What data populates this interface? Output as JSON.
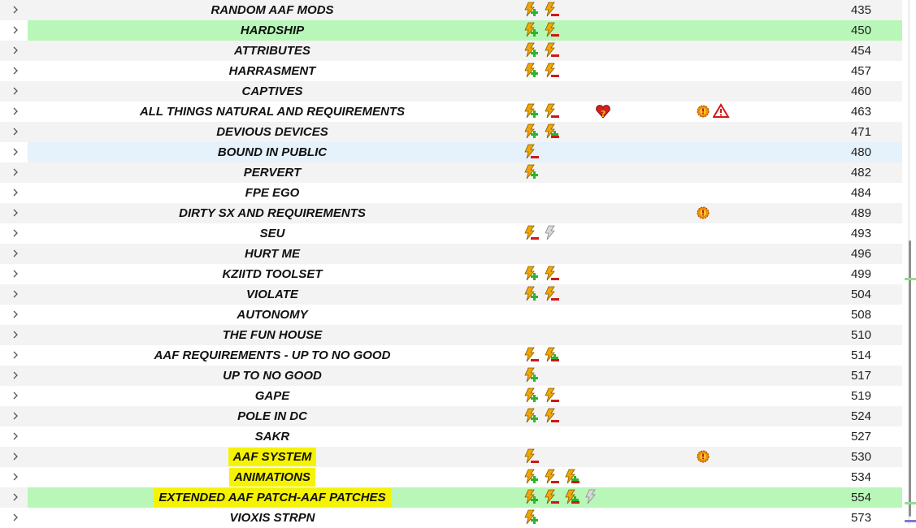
{
  "rows": [
    {
      "name": "RANDOM AAF MODS",
      "priority": "435",
      "icons": [
        "plugin-add",
        "plugin-remove"
      ],
      "extras": []
    },
    {
      "name": "HARDSHIP",
      "priority": "450",
      "highlight": "green",
      "icons": [
        "plugin-add",
        "plugin-remove"
      ],
      "extras": []
    },
    {
      "name": "ATTRIBUTES",
      "priority": "454",
      "icons": [
        "plugin-add",
        "plugin-remove"
      ],
      "extras": []
    },
    {
      "name": "HARRASMENT",
      "priority": "457",
      "icons": [
        "plugin-add",
        "plugin-remove"
      ],
      "extras": []
    },
    {
      "name": "CAPTIVES",
      "priority": "460",
      "icons": [],
      "extras": []
    },
    {
      "name": "ALL THINGS NATURAL AND REQUIREMENTS",
      "priority": "463",
      "icons": [
        "plugin-add",
        "plugin-remove"
      ],
      "extras": [
        "heart-question",
        "gear-badge",
        "warning"
      ]
    },
    {
      "name": "DEVIOUS DEVICES",
      "priority": "471",
      "icons": [
        "plugin-add",
        "plugin-add-remove"
      ],
      "extras": []
    },
    {
      "name": "BOUND IN PUBLIC",
      "priority": "480",
      "highlight": "blue",
      "icons": [
        "plugin-remove"
      ],
      "extras": []
    },
    {
      "name": "PERVERT",
      "priority": "482",
      "icons": [
        "plugin-add"
      ],
      "extras": []
    },
    {
      "name": "FPE EGO",
      "priority": "484",
      "icons": [],
      "extras": []
    },
    {
      "name": "DIRTY SX AND REQUIREMENTS",
      "priority": "489",
      "icons": [],
      "extras": [
        "gear-badge"
      ]
    },
    {
      "name": "SEU",
      "priority": "493",
      "icons": [
        "plugin-remove",
        "plugin-grey"
      ],
      "extras": []
    },
    {
      "name": "HURT ME",
      "priority": "496",
      "icons": [],
      "extras": []
    },
    {
      "name": "KZIITD TOOLSET",
      "priority": "499",
      "icons": [
        "plugin-add",
        "plugin-remove"
      ],
      "extras": []
    },
    {
      "name": "VIOLATE",
      "priority": "504",
      "icons": [
        "plugin-add",
        "plugin-remove"
      ],
      "extras": []
    },
    {
      "name": "AUTONOMY",
      "priority": "508",
      "icons": [],
      "extras": []
    },
    {
      "name": "THE FUN HOUSE",
      "priority": "510",
      "icons": [],
      "extras": []
    },
    {
      "name": "AAF REQUIREMENTS - UP TO NO GOOD",
      "priority": "514",
      "icons": [
        "plugin-remove",
        "plugin-add-remove"
      ],
      "extras": []
    },
    {
      "name": "UP TO NO GOOD",
      "priority": "517",
      "icons": [
        "plugin-add"
      ],
      "extras": []
    },
    {
      "name": "GAPE",
      "priority": "519",
      "icons": [
        "plugin-add",
        "plugin-remove"
      ],
      "extras": []
    },
    {
      "name": "POLE IN DC",
      "priority": "524",
      "icons": [
        "plugin-add",
        "plugin-remove"
      ],
      "extras": []
    },
    {
      "name": "SAKR",
      "priority": "527",
      "icons": [],
      "extras": []
    },
    {
      "name": "AAF SYSTEM",
      "priority": "530",
      "marked": true,
      "icons": [
        "plugin-remove"
      ],
      "extras": [
        "gear-badge"
      ]
    },
    {
      "name": "ANIMATIONS",
      "priority": "534",
      "marked": true,
      "icons": [
        "plugin-add",
        "plugin-remove",
        "plugin-add-remove"
      ],
      "extras": []
    },
    {
      "name": "EXTENDED AAF PATCH-AAF PATCHES",
      "priority": "554",
      "highlight": "green",
      "marked": true,
      "icons": [
        "plugin-add",
        "plugin-remove",
        "plugin-add-remove",
        "plugin-grey"
      ],
      "extras": []
    },
    {
      "name": "VIOXIS STRPN",
      "priority": "573",
      "icons": [
        "plugin-add"
      ],
      "extras": []
    }
  ],
  "colors": {
    "green_highlight": "#b8f7b8",
    "blue_highlight": "#e5f1fb",
    "yellow_mark": "#f5f300",
    "bolt": "#f0a800",
    "add": "#2ab52a",
    "remove": "#d01818"
  }
}
